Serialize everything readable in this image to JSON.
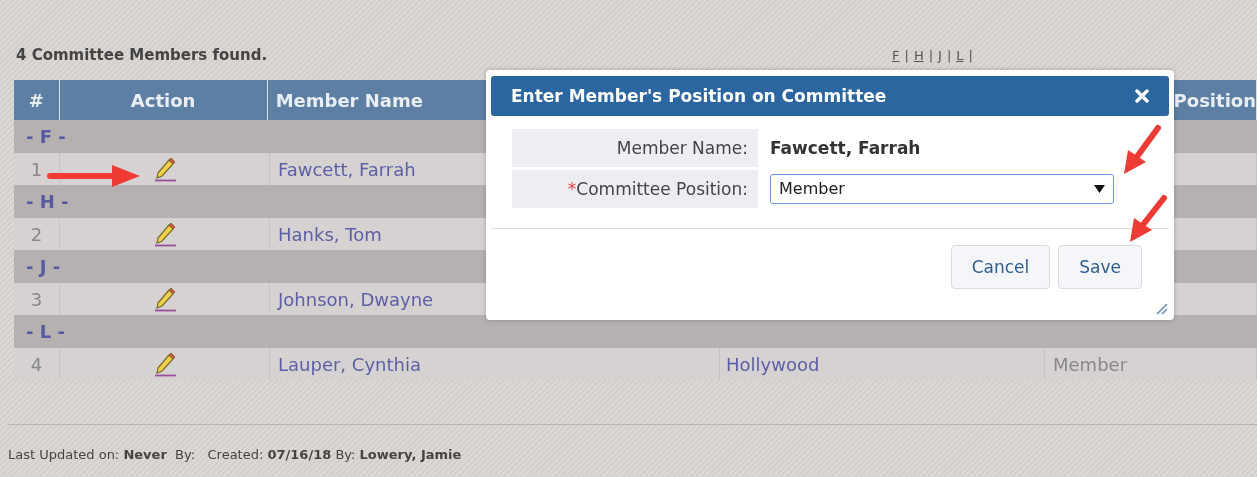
{
  "summary": "4 Committee Members found.",
  "letter_links": [
    {
      "label": "F",
      "separator": "|"
    },
    {
      "label": "H",
      "separator": "|"
    },
    {
      "label": "J",
      "separator": "|"
    },
    {
      "label": "L",
      "separator": "|"
    }
  ],
  "table": {
    "columns": [
      "#",
      "Action",
      "Member Name",
      "Position"
    ],
    "rows": [
      {
        "kind": "group",
        "label": "- F -"
      },
      {
        "kind": "member",
        "number": "1",
        "name": "Fawcett, Farrah"
      },
      {
        "kind": "group",
        "label": "- H -"
      },
      {
        "kind": "member",
        "number": "2",
        "name": "Hanks, Tom"
      },
      {
        "kind": "group",
        "label": "- J -"
      },
      {
        "kind": "member",
        "number": "3",
        "name": "Johnson, Dwayne"
      },
      {
        "kind": "group",
        "label": "- L -"
      },
      {
        "kind": "member",
        "number": "4",
        "name": "Lauper, Cynthia",
        "column_4": "Hollywood",
        "position": "Member"
      }
    ]
  },
  "dialog": {
    "title": "Enter Member's Position on Committee",
    "fields": [
      {
        "kind": "text",
        "label": "Member Name:",
        "value": "Fawcett, Farrah"
      },
      {
        "kind": "select",
        "label": "Committee Position:",
        "required_mark": "*",
        "value": "Member"
      }
    ],
    "buttons": [
      "Cancel",
      "Save"
    ]
  },
  "footer": "Last Updated on: **Never**  By:   Created: **07/16/18** By: **Lowery, Jamie**"
}
